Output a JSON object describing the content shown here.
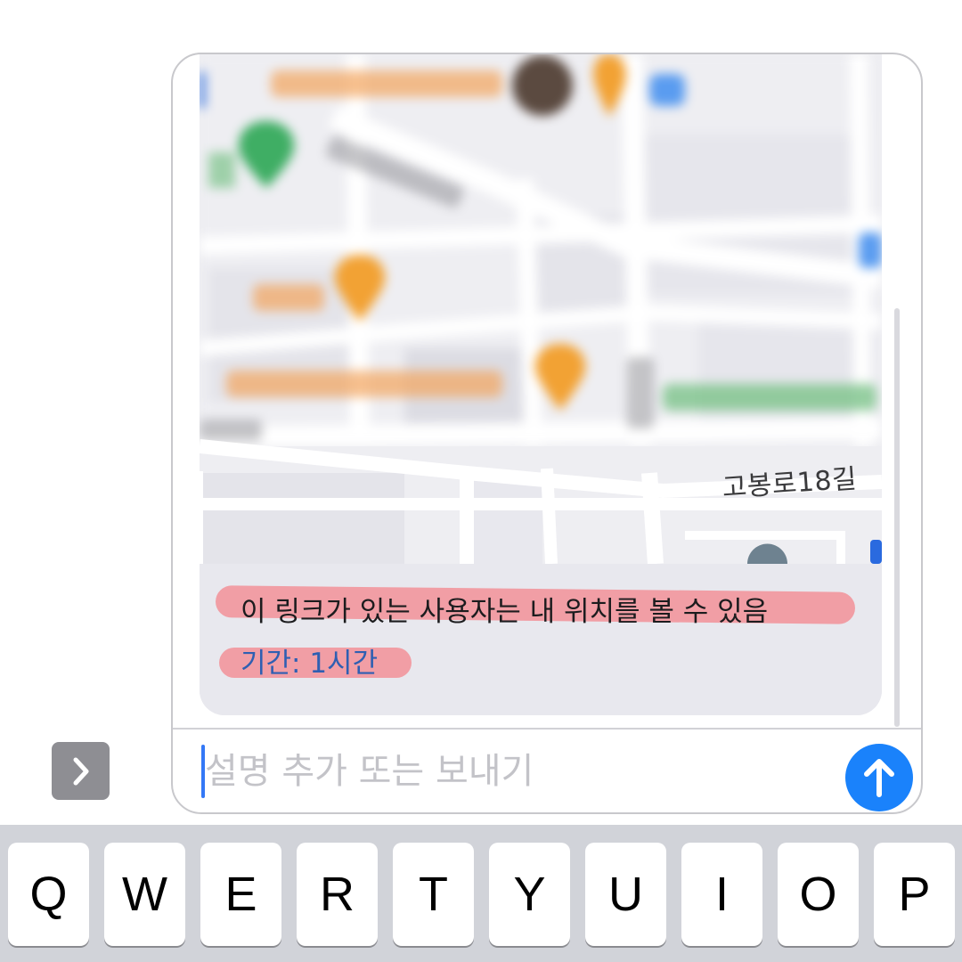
{
  "compose": {
    "street_label": "고봉로18길",
    "caption_title": "이 링크가 있는 사용자는 내 위치를 볼 수 있음",
    "caption_duration": "기간: 1시간",
    "input_placeholder": "설명 추가 또는 보내기"
  },
  "keyboard": {
    "row1": [
      "Q",
      "W",
      "E",
      "R",
      "T",
      "Y",
      "U",
      "I",
      "O",
      "P"
    ]
  },
  "icons": {
    "expand": "chevron-right-icon",
    "send": "arrow-up-icon",
    "map_pins": [
      "place-pin-icon",
      "food-pin-icon",
      "bus-stop-icon"
    ]
  },
  "colors": {
    "send_button": "#1a82fb",
    "caret": "#3478f6",
    "highlight": "#f4868c",
    "keyboard_bg": "#d1d3d9",
    "expand_button": "#8e8e93"
  }
}
